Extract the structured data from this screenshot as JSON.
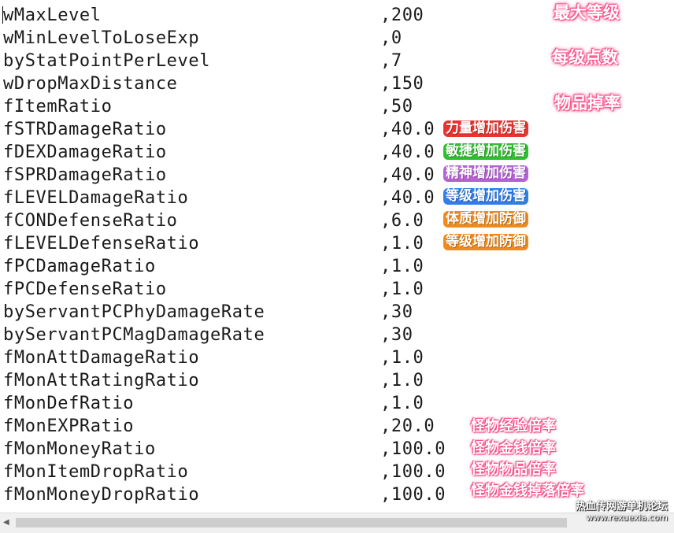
{
  "rows": [
    {
      "key": "wMaxLevel",
      "value": ",200"
    },
    {
      "key": "wMinLevelToLoseExp",
      "value": ",0"
    },
    {
      "key": "byStatPointPerLevel",
      "value": ",7"
    },
    {
      "key": "wDropMaxDistance",
      "value": ",150"
    },
    {
      "key": "fItemRatio",
      "value": ",50"
    },
    {
      "key": "fSTRDamageRatio",
      "value": ",40.0"
    },
    {
      "key": "fDEXDamageRatio",
      "value": ",40.0"
    },
    {
      "key": "fSPRDamageRatio",
      "value": ",40.0"
    },
    {
      "key": "fLEVELDamageRatio",
      "value": ",40.0"
    },
    {
      "key": "fCONDefenseRatio",
      "value": ",6.0"
    },
    {
      "key": "fLEVELDefenseRatio",
      "value": ",1.0"
    },
    {
      "key": "fPCDamageRatio",
      "value": ",1.0"
    },
    {
      "key": "fPCDefenseRatio",
      "value": ",1.0"
    },
    {
      "key": "byServantPCPhyDamageRate",
      "value": ",30"
    },
    {
      "key": "byServantPCMagDamageRate",
      "value": ",30"
    },
    {
      "key": "fMonAttDamageRatio",
      "value": ",1.0"
    },
    {
      "key": "fMonAttRatingRatio",
      "value": ",1.0"
    },
    {
      "key": "fMonDefRatio",
      "value": ",1.0"
    },
    {
      "key": "fMonEXPRatio",
      "value": ",20.0"
    },
    {
      "key": "fMonMoneyRatio",
      "value": ",100.0"
    },
    {
      "key": "fMonItemDropRatio",
      "value": ",100.0"
    },
    {
      "key": "fMonMoneyDropRatio",
      "value": ",100.0"
    }
  ],
  "annotations": {
    "max_level": "最大等级",
    "stat_points": "每级点数",
    "item_rate": "物品掉率",
    "str_damage": "力量增加伤害",
    "dex_damage": "敏捷增加伤害",
    "spr_damage": "精神增加伤害",
    "level_damage": "等级增加伤害",
    "con_defense": "体质增加防御",
    "level_defense": "等级增加防御",
    "mon_exp": "怪物经验倍率",
    "mon_money": "怪物金钱倍率",
    "mon_item": "怪物物品倍率",
    "mon_money_drop": "怪物金钱掉落倍率"
  },
  "colors": {
    "str_pill": "#e8332f",
    "dex_pill": "#2fbf2f",
    "spr_pill": "#b463d6",
    "level_dmg_pill": "#2f7fe8",
    "con_pill": "#f08a1c",
    "level_def_pill": "#f08a1c",
    "glow_pink": "#ff4d86"
  },
  "scrollbar": {
    "left_arrow": "◀"
  },
  "watermark": {
    "line1": "热血传网游单机论坛",
    "line2": "www.rexuexia.com"
  }
}
